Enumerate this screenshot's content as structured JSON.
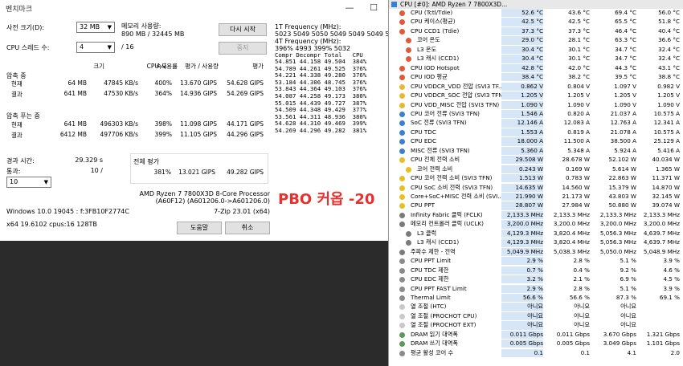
{
  "bench": {
    "title": "벤치마크",
    "dict_label": "사전 크기(D):",
    "dict_value": "32 MB",
    "mem_label": "메모리 사용량:",
    "mem_value": "890 MB / 32445 MB",
    "threads_label": "CPU 스레드 수:",
    "threads_value": "4",
    "threads_total": "/ 16",
    "restart_btn": "다시 시작",
    "stop_btn": "중지",
    "freq1_title": "1T Frequency (MHz):",
    "freq1_values": " 5023 5049 5050 5049 5049 5049 5049",
    "freq4_title": "4T Frequency (MHz):",
    "freq4_values": " 396% 4993 399% 5032",
    "log_header": "Compr Decompr Total   CPU",
    "log_lines": [
      "54.851 44.158 49.504  384%",
      "54.789 44.261 49.525  376%",
      "54.221 44.338 49.280  376%",
      "53.184 44.306 48.745  376%",
      "53.843 44.364 49.103  376%",
      "54.087 44.258 49.173  380%",
      "55.015 44.439 49.727  387%",
      "54.509 44.348 49.429  377%",
      "53.561 44.311 48.936  380%",
      "54.628 44.310 49.469  399%",
      "",
      "54.269 44.296 49.282  381%"
    ],
    "col_headers": [
      "크기",
      "속도",
      "CPU 사용률",
      "평가 / 사용량",
      "평가"
    ],
    "compress_title": "압축 중",
    "decompress_title": "압축 푸는 중",
    "compress_rows": [
      {
        "label": "현재",
        "size": "64 MB",
        "speed": "47845 KB/s",
        "cpu": "400%",
        "rpu": "13.670 GIPS",
        "rating": "54.628 GIPS"
      },
      {
        "label": "결과",
        "size": "641 MB",
        "speed": "47530 KB/s",
        "cpu": "364%",
        "rpu": "14.936 GIPS",
        "rating": "54.269 GIPS"
      }
    ],
    "decompress_rows": [
      {
        "label": "현재",
        "size": "641 MB",
        "speed": "496303 KB/s",
        "cpu": "398%",
        "rpu": "11.098 GIPS",
        "rating": "44.171 GIPS"
      },
      {
        "label": "결과",
        "size": "6412 MB",
        "speed": "497706 KB/s",
        "cpu": "399%",
        "rpu": "11.105 GIPS",
        "rating": "44.296 GIPS"
      }
    ],
    "elapsed_label": "경과 시간:",
    "elapsed_value": "29.329 s",
    "passes_label": "통과:",
    "passes_value": "10 /",
    "passes_select": "10",
    "total_label": "전체 평가",
    "total_cpu": "381%",
    "total_rpu": "13.021 GIPS",
    "total_rating": "49.282 GIPS",
    "cpu_name": "AMD Ryzen 7 7800X3D 8-Core Processor",
    "cpu_id": "(A60F12) (A601206.0->A601206.0)",
    "os_info": "Windows 10.0 19045 : f:3FB10F2774C",
    "zip_version": "7-Zip 23.01 (x64)",
    "sys_info": "x64 19.6102 cpus:16 128TB",
    "help_btn": "도움말",
    "cancel_btn": "취소",
    "overlay_text": "PBO 커옵 -20"
  },
  "hwinfo": {
    "header": "CPU [#0]: AMD Ryzen 7 7800X3D...",
    "rows": [
      {
        "icon": "therm",
        "name": "CPU (Tctl/Tdie)",
        "cur": "52.6 °C",
        "min": "43.6 °C",
        "max": "69.4 °C",
        "avg": "56.0 °C"
      },
      {
        "icon": "therm",
        "name": "CPU 케이스(평균)",
        "cur": "42.5 °C",
        "min": "42.5 °C",
        "max": "65.5 °C",
        "avg": "51.8 °C"
      },
      {
        "icon": "therm",
        "name": "CPU CCD1 (Tdie)",
        "cur": "37.3 °C",
        "min": "37.3 °C",
        "max": "46.4 °C",
        "avg": "40.4 °C"
      },
      {
        "icon": "therm",
        "name": "코어 온도",
        "cur": "29.0 °C",
        "min": "28.1 °C",
        "max": "63.3 °C",
        "avg": "36.6 °C"
      },
      {
        "icon": "therm",
        "name": "L3 온도",
        "cur": "30.4 °C",
        "min": "30.1 °C",
        "max": "34.7 °C",
        "avg": "32.4 °C"
      },
      {
        "icon": "therm",
        "name": "L3 캐시 (CCD1)",
        "cur": "30.4 °C",
        "min": "30.1 °C",
        "max": "34.7 °C",
        "avg": "32.4 °C"
      },
      {
        "icon": "therm",
        "name": "CPU IOD Hotspot",
        "cur": "42.8 °C",
        "min": "42.0 °C",
        "max": "44.3 °C",
        "avg": "43.1 °C"
      },
      {
        "icon": "therm",
        "name": "CPU IOD 평균",
        "cur": "38.4 °C",
        "min": "38.2 °C",
        "max": "39.5 °C",
        "avg": "38.8 °C"
      },
      {
        "icon": "volt",
        "name": "CPU VDDCR_VDD 전압 (SVI3 TF...",
        "cur": "0.862 V",
        "min": "0.804 V",
        "max": "1.097 V",
        "avg": "0.982 V"
      },
      {
        "icon": "volt",
        "name": "CPU VDDCR_SOC 전압 (SVI3 TFN)",
        "cur": "1.205 V",
        "min": "1.205 V",
        "max": "1.205 V",
        "avg": "1.205 V"
      },
      {
        "icon": "volt",
        "name": "CPU VDD_MISC 전압 (SVI3 TFN)",
        "cur": "1.090 V",
        "min": "1.090 V",
        "max": "1.090 V",
        "avg": "1.090 V"
      },
      {
        "icon": "amp",
        "name": "CPU 코어 전류 (SVI3 TFN)",
        "cur": "1.546 A",
        "min": "0.820 A",
        "max": "21.037 A",
        "avg": "10.575 A"
      },
      {
        "icon": "amp",
        "name": "SoC 전류 (SVI3 TFN)",
        "cur": "12.146 A",
        "min": "12.083 A",
        "max": "12.763 A",
        "avg": "12.341 A"
      },
      {
        "icon": "amp",
        "name": "CPU TDC",
        "cur": "1.553 A",
        "min": "0.819 A",
        "max": "21.078 A",
        "avg": "10.575 A"
      },
      {
        "icon": "amp",
        "name": "CPU EDC",
        "cur": "18.000 A",
        "min": "11.500 A",
        "max": "38.500 A",
        "avg": "25.129 A"
      },
      {
        "icon": "amp",
        "name": "MISC 전류 (SVI3 TFN)",
        "cur": "5.360 A",
        "min": "5.348 A",
        "max": "5.924 A",
        "avg": "5.416 A"
      },
      {
        "icon": "pow",
        "name": "CPU 전체 전력 소비",
        "cur": "29.508 W",
        "min": "28.678 W",
        "max": "52.102 W",
        "avg": "40.034 W"
      },
      {
        "icon": "pow",
        "name": "코어 전력 소비",
        "cur": "0.243 W",
        "min": "0.169 W",
        "max": "5.614 W",
        "avg": "1.365 W"
      },
      {
        "icon": "pow",
        "name": "CPU 코어 전력 소비 (SVI3 TFN)",
        "cur": "1.513 W",
        "min": "0.783 W",
        "max": "22.863 W",
        "avg": "11.371 W"
      },
      {
        "icon": "pow",
        "name": "CPU SoC 소비 전력 (SVI3 TFN)",
        "cur": "14.635 W",
        "min": "14.560 W",
        "max": "15.379 W",
        "avg": "14.870 W"
      },
      {
        "icon": "pow",
        "name": "Core+SoC+MISC 전력 소비 (SVI...",
        "cur": "21.990 W",
        "min": "21.173 W",
        "max": "43.803 W",
        "avg": "32.145 W"
      },
      {
        "icon": "pow",
        "name": "CPU PPT",
        "cur": "28.807 W",
        "min": "27.984 W",
        "max": "50.880 W",
        "avg": "39.074 W"
      },
      {
        "icon": "clk",
        "name": "Infinity Fabric 클럭 (FCLK)",
        "cur": "2,133.3 MHz",
        "min": "2,133.3 MHz",
        "max": "2,133.3 MHz",
        "avg": "2,133.3 MHz"
      },
      {
        "icon": "clk",
        "name": "메모리 컨트롤러 클럭 (UCLK)",
        "cur": "3,200.0 MHz",
        "min": "3,200.0 MHz",
        "max": "3,200.0 MHz",
        "avg": "3,200.0 MHz"
      },
      {
        "icon": "clk",
        "name": "L3 클럭",
        "cur": "4,129.3 MHz",
        "min": "3,820.4 MHz",
        "max": "5,056.3 MHz",
        "avg": "4,639.7 MHz"
      },
      {
        "icon": "clk",
        "name": "L3 캐시 (CCD1)",
        "cur": "4,129.3 MHz",
        "min": "3,820.4 MHz",
        "max": "5,056.3 MHz",
        "avg": "4,639.7 MHz"
      },
      {
        "icon": "clk",
        "name": "주파수 제한 - 전역",
        "cur": "5,049.9 MHz",
        "min": "5,038.3 MHz",
        "max": "5,050.0 MHz",
        "avg": "5,048.9 MHz"
      },
      {
        "icon": "pct",
        "name": "CPU PPT Limit",
        "cur": "2.9 %",
        "min": "2.8 %",
        "max": "5.1 %",
        "avg": "3.9 %"
      },
      {
        "icon": "pct",
        "name": "CPU TDC 제한",
        "cur": "0.7 %",
        "min": "0.4 %",
        "max": "9.2 %",
        "avg": "4.6 %"
      },
      {
        "icon": "pct",
        "name": "CPU EDC 제한",
        "cur": "3.2 %",
        "min": "2.1 %",
        "max": "6.9 %",
        "avg": "4.5 %"
      },
      {
        "icon": "pct",
        "name": "CPU PPT FAST Limit",
        "cur": "2.9 %",
        "min": "2.8 %",
        "max": "5.1 %",
        "avg": "3.9 %"
      },
      {
        "icon": "pct",
        "name": "Thermal Limit",
        "cur": "56.6 %",
        "min": "56.6 %",
        "max": "87.3 %",
        "avg": "69.1 %"
      },
      {
        "icon": "flag",
        "name": "열 조절 (HTC)",
        "cur": "아니요",
        "min": "아니요",
        "max": "아니요",
        "avg": ""
      },
      {
        "icon": "flag",
        "name": "열 조절 (PROCHOT CPU)",
        "cur": "아니요",
        "min": "아니요",
        "max": "아니요",
        "avg": ""
      },
      {
        "icon": "flag",
        "name": "열 조절 (PROCHOT EXT)",
        "cur": "아니요",
        "min": "아니요",
        "max": "아니요",
        "avg": ""
      },
      {
        "icon": "mem",
        "name": "DRAM 읽기 대역폭",
        "cur": "0.011 Gbps",
        "min": "0.011 Gbps",
        "max": "3.670 Gbps",
        "avg": "1.321 Gbps"
      },
      {
        "icon": "mem",
        "name": "DRAM 쓰기 대역폭",
        "cur": "0.005 Gbps",
        "min": "0.005 Gbps",
        "max": "3.049 Gbps",
        "avg": "1.101 Gbps"
      },
      {
        "icon": "pct",
        "name": "평균 활성 코어 수",
        "cur": "0.1",
        "min": "0.1",
        "max": "4.1",
        "avg": "2.0"
      }
    ]
  }
}
